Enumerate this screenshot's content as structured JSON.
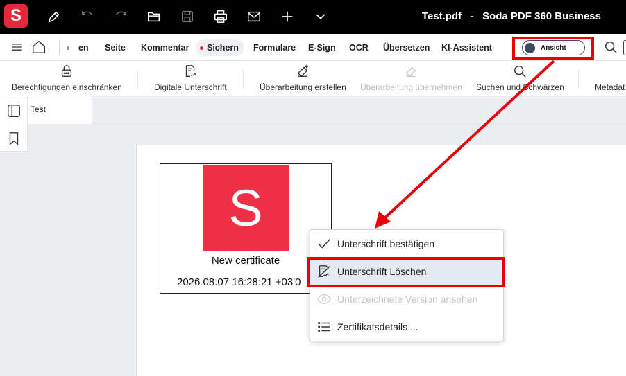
{
  "titlebar": {
    "logo_letter": "S",
    "title": "Test.pdf   -   Soda PDF 360 Business"
  },
  "nav": {
    "back_label": "en",
    "tabs": [
      "Seite",
      "Kommentar",
      "Sichern",
      "Formulare",
      "E-Sign",
      "OCR",
      "Übersetzen",
      "KI-Assistent"
    ],
    "active_tab": "Sichern",
    "toggle_label": "Ansicht"
  },
  "ribbon": {
    "items": [
      {
        "label": "Berechtigungen einschränken",
        "icon": "lock-icon",
        "enabled": true
      },
      {
        "label": "Digitale Unterschrift",
        "icon": "signature-icon",
        "enabled": true
      },
      {
        "label": "Überarbeitung erstellen",
        "icon": "eraser-plus-icon",
        "enabled": true
      },
      {
        "label": "Überarbeitung übernehmen",
        "icon": "eraser-check-icon",
        "enabled": false
      },
      {
        "label": "Suchen und Schwärzen",
        "icon": "search-icon",
        "enabled": true
      },
      {
        "label": "Metadat",
        "icon": "metadata-icon",
        "enabled": true
      }
    ]
  },
  "document": {
    "tab_label": "Test",
    "signature": {
      "logo_letter": "S",
      "name": "New certificate",
      "date": "2026.08.07 16:28:21 +03'0"
    }
  },
  "context_menu": {
    "items": [
      {
        "label": "Unterschrift bestätigen",
        "icon": "checkmark-icon",
        "enabled": true
      },
      {
        "label": "Unterschrift Löschen",
        "icon": "signature-delete-icon",
        "enabled": true,
        "highlighted": true
      },
      {
        "label": "Unterzeichnete Version ansehen",
        "icon": "eye-icon",
        "enabled": false
      },
      {
        "label": "Zertifikatsdetails ...",
        "icon": "list-icon",
        "enabled": true
      }
    ]
  },
  "colors": {
    "brand_red": "#e6283b",
    "annotation_red": "#e8000b",
    "highlight": "#e4e9f2"
  }
}
